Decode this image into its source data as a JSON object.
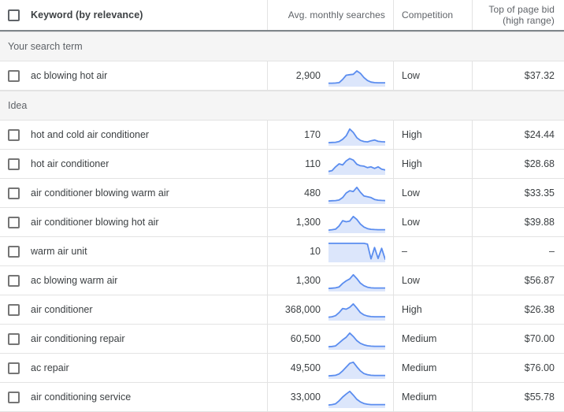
{
  "table": {
    "columns": {
      "keyword": "Keyword (by relevance)",
      "avg_monthly_searches": "Avg. monthly searches",
      "competition": "Competition",
      "top_of_page_bid_line1": "Top of page bid",
      "top_of_page_bid_line2": "(high range)"
    },
    "groups": [
      {
        "label": "Your search term",
        "rows": [
          {
            "keyword": "ac blowing hot air",
            "avg_monthly_searches": "2,900",
            "competition": "Low",
            "top_of_page_bid": "$37.32",
            "sparkline": [
              10,
              10,
              11,
              13,
              30,
              52,
              55,
              57,
              75,
              62,
              40,
              24,
              16,
              13,
              12,
              12,
              12
            ]
          }
        ]
      },
      {
        "label": "Idea",
        "rows": [
          {
            "keyword": "hot and cold air conditioner",
            "avg_monthly_searches": "170",
            "competition": "High",
            "top_of_page_bid": "$24.44",
            "sparkline": [
              8,
              9,
              10,
              14,
              26,
              44,
              80,
              62,
              34,
              20,
              14,
              12,
              18,
              22,
              15,
              13,
              12
            ]
          },
          {
            "keyword": "hot air conditioner",
            "avg_monthly_searches": "110",
            "competition": "High",
            "top_of_page_bid": "$28.68",
            "sparkline": [
              10,
              14,
              34,
              50,
              44,
              66,
              78,
              70,
              48,
              40,
              38,
              30,
              34,
              26,
              34,
              22,
              18
            ]
          },
          {
            "keyword": "air conditioner blowing warm air",
            "avg_monthly_searches": "480",
            "competition": "Low",
            "top_of_page_bid": "$33.35",
            "sparkline": [
              8,
              9,
              10,
              13,
              26,
              50,
              62,
              58,
              80,
              54,
              34,
              30,
              26,
              16,
              12,
              11,
              10
            ]
          },
          {
            "keyword": "air conditioner blowing hot air",
            "avg_monthly_searches": "1,300",
            "competition": "Low",
            "top_of_page_bid": "$39.88",
            "sparkline": [
              8,
              10,
              13,
              30,
              58,
              52,
              56,
              80,
              64,
              40,
              24,
              16,
              12,
              11,
              10,
              10,
              10
            ]
          },
          {
            "keyword": "warm air unit",
            "avg_monthly_searches": "10",
            "competition": "–",
            "top_of_page_bid": "–",
            "sparkline": [
              92,
              92,
              92,
              92,
              92,
              92,
              92,
              92,
              92,
              92,
              92,
              88,
              10,
              70,
              12,
              66,
              8
            ]
          },
          {
            "keyword": "ac blowing warm air",
            "avg_monthly_searches": "1,300",
            "competition": "Low",
            "top_of_page_bid": "$56.87",
            "sparkline": [
              8,
              9,
              11,
              16,
              34,
              48,
              58,
              80,
              60,
              36,
              22,
              14,
              11,
              10,
              10,
              10,
              10
            ]
          },
          {
            "keyword": "air conditioner",
            "avg_monthly_searches": "368,000",
            "competition": "High",
            "top_of_page_bid": "$26.38",
            "sparkline": [
              10,
              12,
              18,
              34,
              56,
              52,
              62,
              80,
              58,
              34,
              22,
              16,
              13,
              12,
              12,
              12,
              12
            ]
          },
          {
            "keyword": "air conditioning repair",
            "avg_monthly_searches": "60,500",
            "competition": "Medium",
            "top_of_page_bid": "$70.00",
            "sparkline": [
              8,
              9,
              12,
              28,
              44,
              58,
              80,
              62,
              40,
              26,
              18,
              13,
              11,
              10,
              10,
              10,
              10
            ]
          },
          {
            "keyword": "ac repair",
            "avg_monthly_searches": "49,500",
            "competition": "Medium",
            "top_of_page_bid": "$76.00",
            "sparkline": [
              8,
              9,
              11,
              18,
              34,
              54,
              74,
              80,
              56,
              34,
              20,
              14,
              11,
              10,
              10,
              10,
              10
            ]
          },
          {
            "keyword": "air conditioning service",
            "avg_monthly_searches": "33,000",
            "competition": "Medium",
            "top_of_page_bid": "$55.78",
            "sparkline": [
              8,
              10,
              14,
              30,
              50,
              66,
              80,
              60,
              38,
              24,
              16,
              12,
              10,
              10,
              10,
              10,
              10
            ]
          }
        ]
      }
    ]
  },
  "colors": {
    "spark_line": "#5b8def",
    "spark_fill": "#dce6fb",
    "group_bg": "#f5f5f5",
    "divider": "#e3e3e3",
    "header_underline": "#80868b",
    "text": "#3c4043",
    "muted_text": "#5f6368"
  }
}
